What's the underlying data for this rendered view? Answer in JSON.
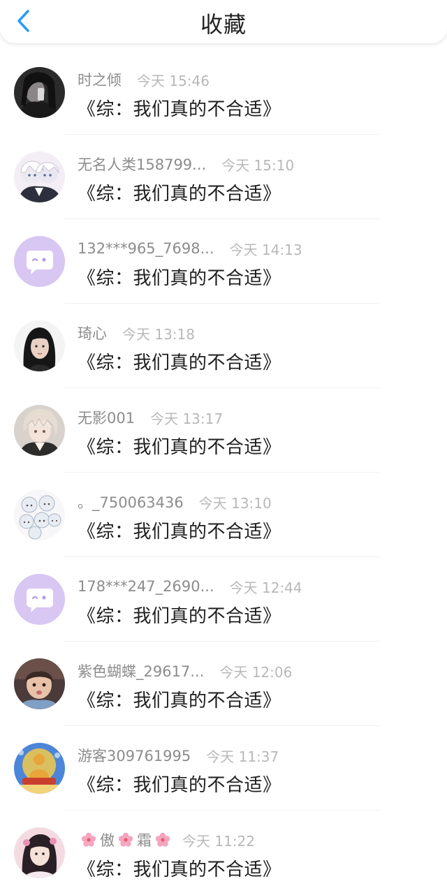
{
  "header": {
    "title": "收藏",
    "back_icon": "chevron-left-icon",
    "accent_color": "#2a9bf4"
  },
  "favorites": [
    {
      "author": "时之倾",
      "time": "今天 15:46",
      "book": "《综：我们真的不合适》",
      "avatar": "photo-dark"
    },
    {
      "author": "无名人类158799...",
      "time": "今天 15:10",
      "book": "《综：我们真的不合适》",
      "avatar": "anime-white-hair"
    },
    {
      "author": "132***965_7698...",
      "time": "今天 14:13",
      "book": "《综：我们真的不合适》",
      "avatar": "default-chat-bubble"
    },
    {
      "author": "琦心",
      "time": "今天 13:18",
      "book": "《综：我们真的不合适》",
      "avatar": "photo-girl"
    },
    {
      "author": "无影001",
      "time": "今天 13:17",
      "book": "《综：我们真的不合适》",
      "avatar": "anime-boy"
    },
    {
      "author": "。_750063436",
      "time": "今天 13:10",
      "book": "《综：我们真的不合适》",
      "avatar": "chibi-group"
    },
    {
      "author": "178***247_2690...",
      "time": "今天 12:44",
      "book": "《综：我们真的不合适》",
      "avatar": "default-chat-bubble"
    },
    {
      "author": "紫色蝴蝶_29617...",
      "time": "今天 12:06",
      "book": "《综：我们真的不合适》",
      "avatar": "photo-child"
    },
    {
      "author": "游客309761995",
      "time": "今天 11:37",
      "book": "《综：我们真的不合适》",
      "avatar": "buddha"
    },
    {
      "author": "傲霜",
      "author_decoration": "cherry-blossom-icon",
      "time": "今天 11:22",
      "book": "《综：我们真的不合适》",
      "avatar": "photo-girl-costume"
    }
  ]
}
